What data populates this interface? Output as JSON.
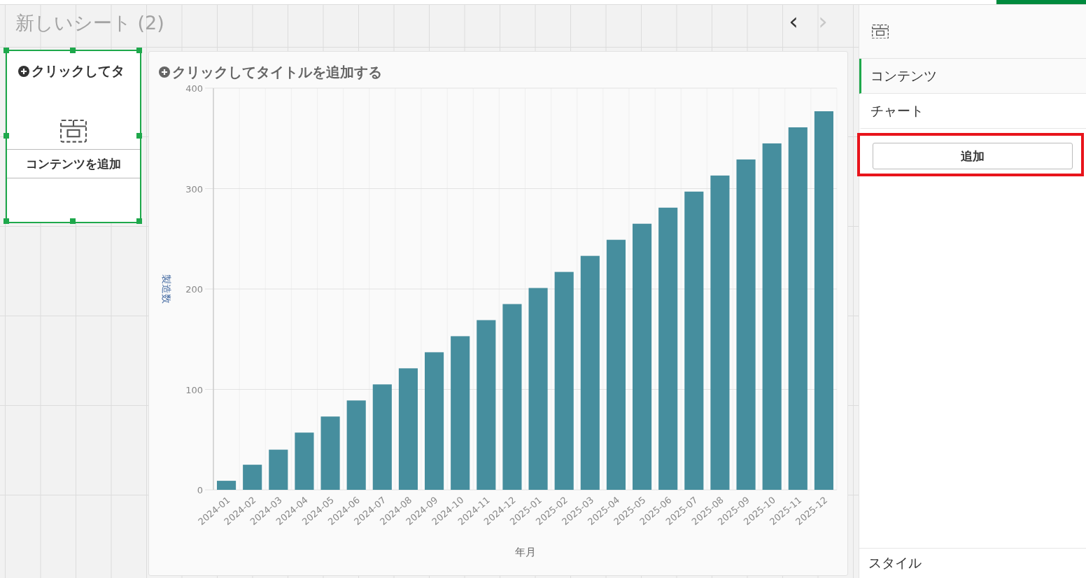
{
  "sheet": {
    "title": "新しいシート (2)",
    "nav": [
      {
        "symbol": "‹",
        "disabled": false
      },
      {
        "symbol": "›",
        "disabled": true
      }
    ]
  },
  "placeholder_card": {
    "selected": true,
    "title": "クリックしてタ",
    "add_label": "コンテンツを追加"
  },
  "chart_card": {
    "title": "クリックしてタイトルを追加する",
    "chart_data": {
      "type": "bar",
      "xlabel": "年月",
      "ylabel": "製造数",
      "categories": [
        "2024-01",
        "2024-02",
        "2024-03",
        "2024-04",
        "2024-05",
        "2024-06",
        "2024-07",
        "2024-08",
        "2024-09",
        "2024-10",
        "2024-11",
        "2024-12",
        "2025-01",
        "2025-02",
        "2025-03",
        "2025-04",
        "2025-05",
        "2025-06",
        "2025-07",
        "2025-08",
        "2025-09",
        "2025-10",
        "2025-11",
        "2025-12"
      ],
      "grid": true,
      "series": [
        {
          "color": "#468e9e",
          "values": [
            9,
            25,
            40,
            57,
            73,
            89,
            105,
            121,
            137,
            153,
            169,
            185,
            201,
            217,
            233,
            249,
            265,
            281,
            297,
            313,
            329,
            345,
            361,
            377
          ]
        }
      ],
      "ylim": [
        0,
        400
      ],
      "yticks": [
        0,
        100,
        200,
        300,
        400
      ]
    }
  },
  "panel": {
    "sections": [
      {
        "label": "コンテンツ",
        "selected": true
      },
      {
        "label": "チャート",
        "selected": false
      }
    ],
    "add_button": {
      "label": "追加",
      "highlighted": true
    },
    "footer": "スタイル"
  }
}
